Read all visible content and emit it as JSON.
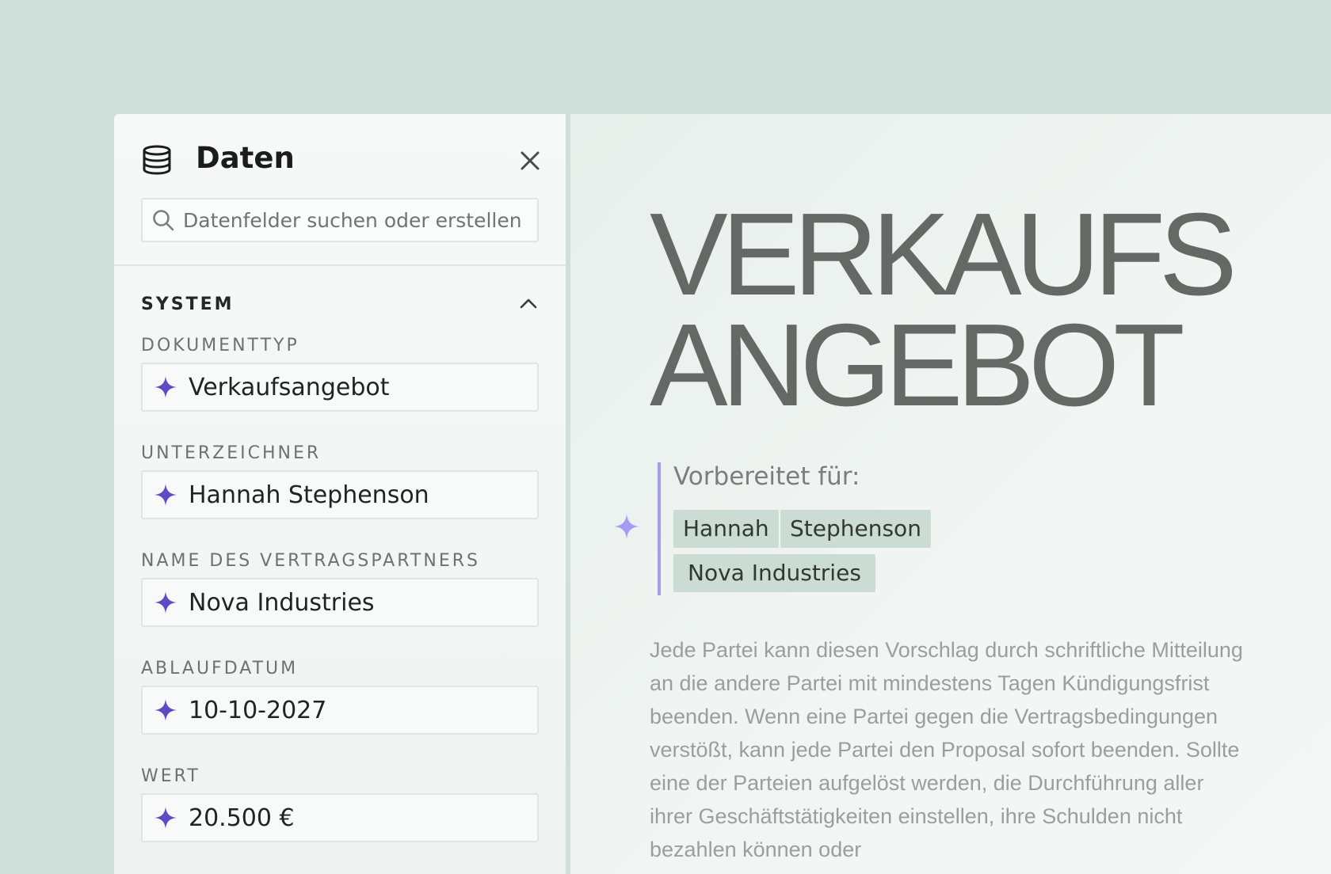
{
  "panel": {
    "title": "Daten",
    "icon": "database-icon",
    "close_icon": "close-icon",
    "search": {
      "placeholder": "Datenfelder suchen oder erstellen",
      "value": ""
    },
    "section": {
      "title": "SYSTEM",
      "expanded": true
    },
    "fields": [
      {
        "label": "DOKUMENTTYP",
        "value": "Verkaufsangebot"
      },
      {
        "label": "UNTERZEICHNER",
        "value": "Hannah Stephenson"
      },
      {
        "label": "NAME DES VERTRAGSPARTNERS",
        "value": "Nova Industries"
      },
      {
        "label": "ABLAUFDATUM",
        "value": "10-10-2027"
      },
      {
        "label": "WERT",
        "value": "20.500 €"
      }
    ]
  },
  "document": {
    "title_line1": "VERKAUFS",
    "title_line2": "ANGEBOT",
    "prepared_label": "Vorbereitet für:",
    "tags": [
      "Hannah",
      "Stephenson",
      "Nova Industries"
    ],
    "body": "Jede Partei kann diesen Vorschlag durch schriftliche Mitteilung an die andere Partei mit mindestens Tagen Kündigungsfrist beenden. Wenn eine Partei gegen die Vertragsbedingungen verstößt, kann jede Partei den Proposal sofort beenden. Sollte eine der Parteien aufgelöst werden, die Durchführung aller ihrer Geschäftstätigkeiten einstellen, ihre Schulden nicht bezahlen können oder"
  },
  "colors": {
    "background": "#cfdfd9",
    "accent": "#5b4bc4",
    "accent_light": "#a69bf2",
    "tag_bg": "#cbdcd5"
  }
}
